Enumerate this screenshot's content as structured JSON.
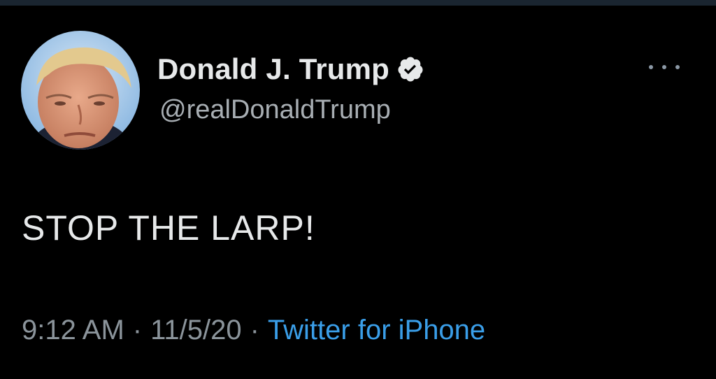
{
  "tweet": {
    "display_name": "Donald J. Trump",
    "handle": "@realDonaldTrump",
    "text": "STOP THE LARP!",
    "time": "9:12 AM",
    "separator": "·",
    "date": "11/5/20",
    "source": "Twitter for iPhone"
  },
  "icons": {
    "verified": "verified-badge-icon",
    "more": "more-options-icon"
  },
  "colors": {
    "background": "#000000",
    "text_primary": "#e7e9ea",
    "text_secondary": "#8b949b",
    "link": "#3a9ee8",
    "verified_badge": "#e7e9ea"
  }
}
